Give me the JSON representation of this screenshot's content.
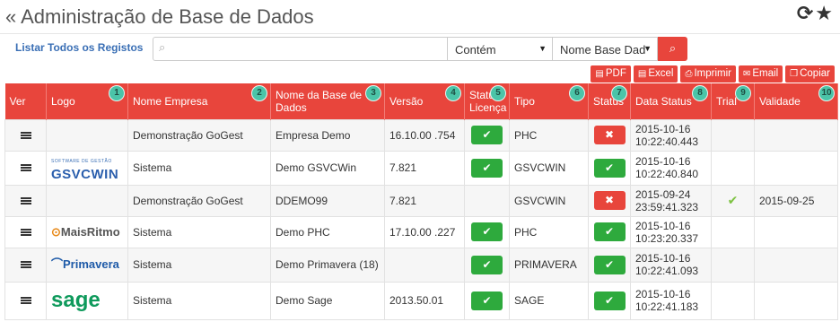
{
  "header": {
    "title": "« Administração de Base de Dados",
    "refresh_icon": "refresh-icon",
    "star_icon": "star-icon"
  },
  "toolbar": {
    "list_all_label": "Listar Todos os Registos",
    "search": {
      "value": "",
      "placeholder": "",
      "icon": "search-icon"
    },
    "operator_select": "Contém",
    "field_select": "Nome Base Dad",
    "search_button_icon": "search-icon"
  },
  "export_buttons": [
    {
      "label": "PDF",
      "icon": "pdf-icon"
    },
    {
      "label": "Excel",
      "icon": "excel-icon"
    },
    {
      "label": "Imprimir",
      "icon": "print-icon"
    },
    {
      "label": "Email",
      "icon": "email-icon"
    },
    {
      "label": "Copiar",
      "icon": "copy-icon"
    }
  ],
  "table": {
    "columns": [
      {
        "label": "Ver",
        "badge": ""
      },
      {
        "label": "Logo",
        "badge": "1"
      },
      {
        "label": "Nome Empresa",
        "badge": "2"
      },
      {
        "label": "Nome da Base de Dados",
        "badge": "3"
      },
      {
        "label": "Versão",
        "badge": "4"
      },
      {
        "label": "Status Licença",
        "badge": "5"
      },
      {
        "label": "Tipo",
        "badge": "6"
      },
      {
        "label": "Status",
        "badge": "7"
      },
      {
        "label": "Data Status",
        "badge": "8"
      },
      {
        "label": "Trial",
        "badge": "9"
      },
      {
        "label": "Validade",
        "badge": "10"
      }
    ],
    "rows": [
      {
        "logo": "",
        "empresa": "Demonstração GoGest",
        "base": "Empresa Demo",
        "versao": "16.10.00 .754",
        "licenca": "ok",
        "tipo": "PHC",
        "status": "bad",
        "data": "2015-10-16 10:22:40.443",
        "trial": false,
        "validade": ""
      },
      {
        "logo": "gsvcwin",
        "empresa": "Sistema",
        "base": "Demo GSVCWin",
        "versao": "7.821",
        "licenca": "ok",
        "tipo": "GSVCWIN",
        "status": "ok",
        "data": "2015-10-16 10:22:40.840",
        "trial": false,
        "validade": ""
      },
      {
        "logo": "",
        "empresa": "Demonstração GoGest",
        "base": "DDEMO99",
        "versao": "7.821",
        "licenca": "none",
        "tipo": "GSVCWIN",
        "status": "bad",
        "data": "2015-09-24 23:59:41.323",
        "trial": true,
        "validade": "2015-09-25"
      },
      {
        "logo": "maisritmo",
        "empresa": "Sistema",
        "base": "Demo PHC",
        "versao": "17.10.00 .227",
        "licenca": "ok",
        "tipo": "PHC",
        "status": "ok",
        "data": "2015-10-16 10:23:20.337",
        "trial": false,
        "validade": ""
      },
      {
        "logo": "primavera",
        "empresa": "Sistema",
        "base": "Demo Primavera (18)",
        "versao": "",
        "licenca": "ok",
        "tipo": "PRIMAVERA",
        "status": "ok",
        "data": "2015-10-16 10:22:41.093",
        "trial": false,
        "validade": ""
      },
      {
        "logo": "sage",
        "empresa": "Sistema",
        "base": "Demo Sage",
        "versao": "2013.50.01",
        "licenca": "ok",
        "tipo": "SAGE",
        "status": "ok",
        "data": "2015-10-16 10:22:41.183",
        "trial": false,
        "validade": ""
      }
    ]
  },
  "logos": {
    "gsvcwin": {
      "small": "SOFTWARE DE GESTÃO",
      "big": "GSVCWIN"
    },
    "maisritmo": {
      "text": "MaisRitmo"
    },
    "primavera": {
      "text": "Primavera"
    },
    "sage": {
      "text": "sage"
    }
  },
  "colors": {
    "accent": "#e8453c",
    "ok": "#2eaa3d",
    "badge": "#4bc4a8",
    "link": "#3a6fb5",
    "trial": "#7dc242"
  }
}
